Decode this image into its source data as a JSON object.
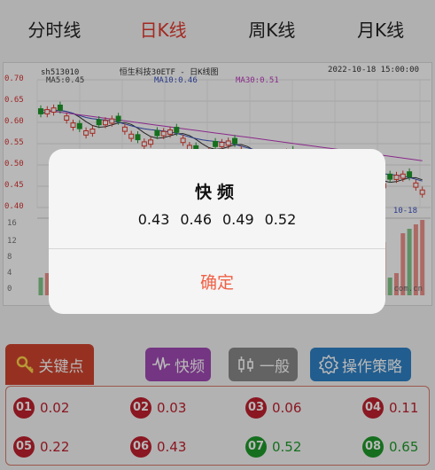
{
  "tabs": [
    "分时线",
    "日K线",
    "周K线",
    "月K线"
  ],
  "active_tab": 1,
  "chart": {
    "code": "sh513010",
    "name": "恒生科技30ETF  -  日K线图",
    "date": "2022-10-18 15:00:00",
    "ma5": "MA5:0.45",
    "ma10": "MA10:0.46",
    "ma30": "MA30:0.51",
    "price_ticks": [
      "0.70",
      "0.65",
      "0.60",
      "0.55",
      "0.50",
      "0.45",
      "0.40"
    ],
    "vol_ticks": [
      "16",
      "12",
      "8",
      "4",
      "0"
    ],
    "x_last": "10-18",
    "watermark": "com.cn",
    "colors": {
      "up": "#e23a2f",
      "down": "#1e9a2a",
      "ma5": "#333333",
      "ma10": "#3a52c0",
      "ma30": "#c03ac0"
    }
  },
  "dialog": {
    "title": "快频",
    "values": [
      "0.43",
      "0.46",
      "0.49",
      "0.52"
    ],
    "ok_label": "确定"
  },
  "toolbar": {
    "key_label": "关键点",
    "fast_label": "快频",
    "general_label": "一般",
    "strategy_label": "操作策略",
    "icons": [
      "key-icon",
      "waveform-icon",
      "candlestick-icon",
      "gear-icon"
    ]
  },
  "key_points": [
    {
      "n": "01",
      "v": "0.02",
      "color": "red"
    },
    {
      "n": "02",
      "v": "0.03",
      "color": "red"
    },
    {
      "n": "03",
      "v": "0.06",
      "color": "red"
    },
    {
      "n": "04",
      "v": "0.11",
      "color": "red"
    },
    {
      "n": "05",
      "v": "0.22",
      "color": "red"
    },
    {
      "n": "06",
      "v": "0.43",
      "color": "red"
    },
    {
      "n": "07",
      "v": "0.52",
      "color": "green"
    },
    {
      "n": "08",
      "v": "0.65",
      "color": "green"
    }
  ]
}
